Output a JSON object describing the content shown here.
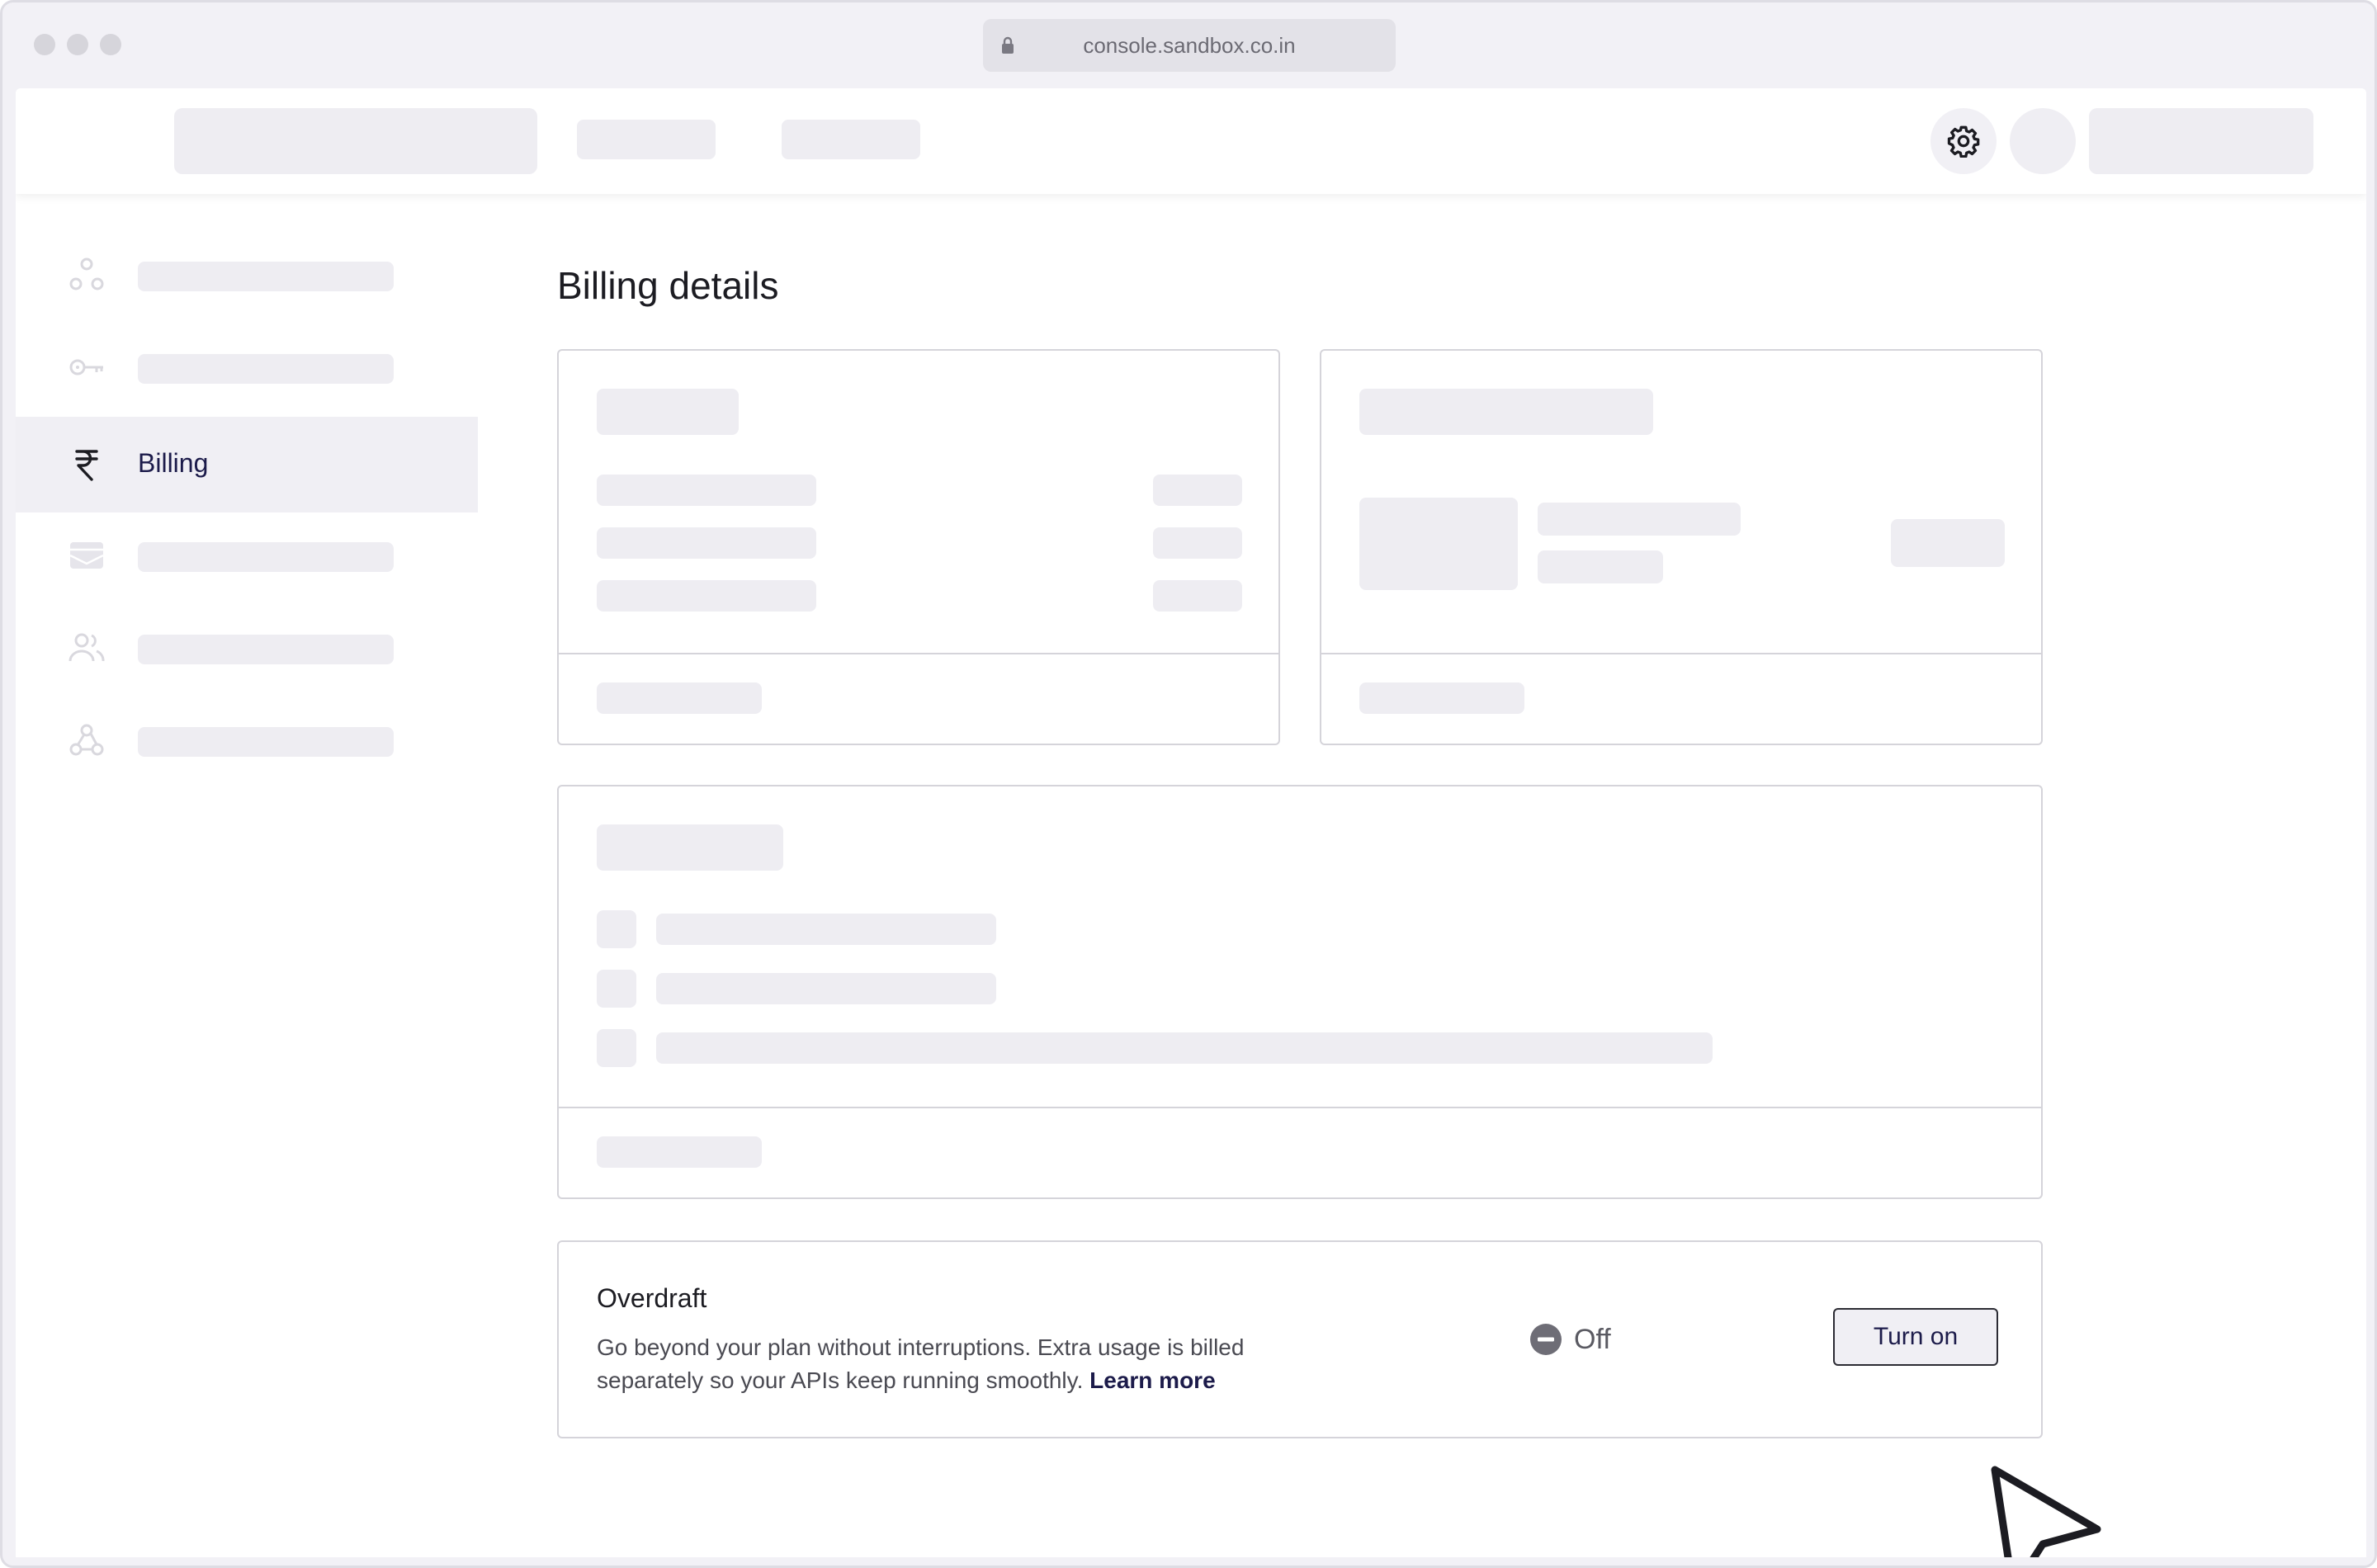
{
  "browser": {
    "url": "console.sandbox.co.in"
  },
  "topbar": {
    "settings_icon": "gear-icon"
  },
  "sidebar": {
    "items": [
      {
        "icon": "nodes-icon",
        "label": ""
      },
      {
        "icon": "key-icon",
        "label": ""
      },
      {
        "icon": "rupee-icon",
        "label": "Billing",
        "active": true
      },
      {
        "icon": "wallet-icon",
        "label": ""
      },
      {
        "icon": "users-icon",
        "label": ""
      },
      {
        "icon": "webhook-icon",
        "label": ""
      }
    ]
  },
  "main": {
    "title": "Billing details",
    "overdraft": {
      "title": "Overdraft",
      "description": "Go beyond your plan without interruptions. Extra usage is billed separately so your APIs keep running smoothly.",
      "link": "Learn more",
      "status_icon": "minus-circle-icon",
      "status": "Off",
      "button": "Turn on"
    }
  },
  "colors": {
    "accent": "#1c1b4a",
    "skeleton": "#eeedf2",
    "border": "#d5d4da"
  }
}
